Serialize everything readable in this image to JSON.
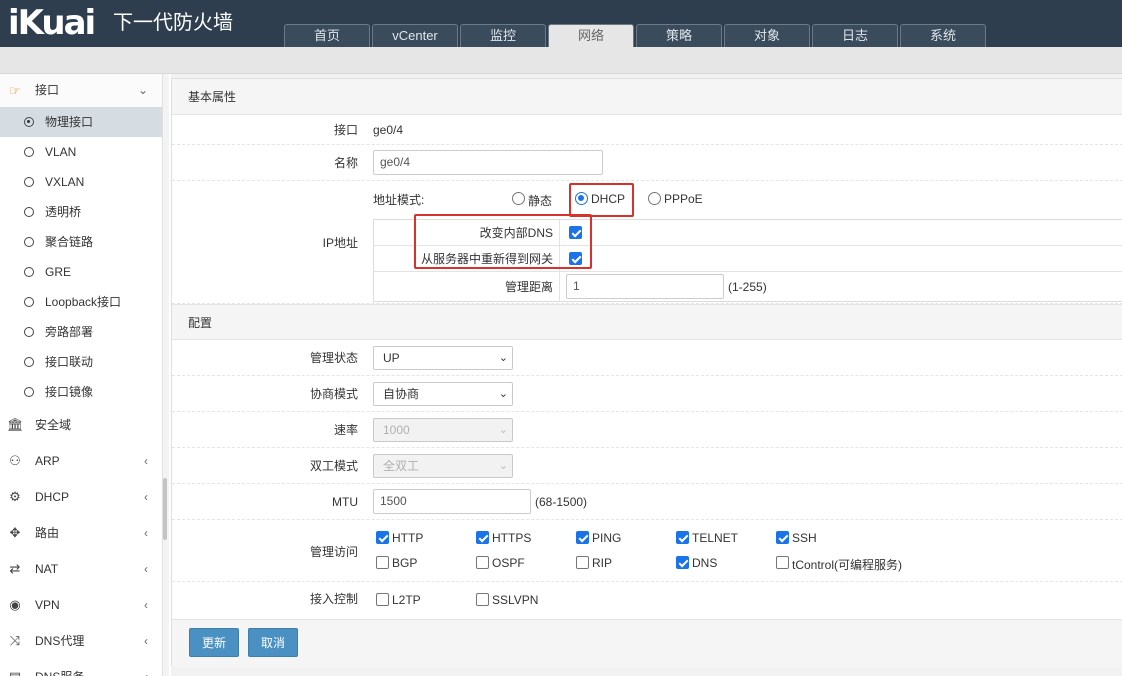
{
  "brand": {
    "logo": "iKuai",
    "subtitle": "下一代防火墙"
  },
  "nav": {
    "tabs": [
      {
        "label": "首页",
        "icon": "none"
      },
      {
        "label": "vCenter"
      },
      {
        "label": "监控"
      },
      {
        "label": "网络",
        "active": true
      },
      {
        "label": "策略"
      },
      {
        "label": "对象"
      },
      {
        "label": "日志"
      },
      {
        "label": "系统"
      }
    ]
  },
  "sidebar": {
    "head": {
      "label": "接口",
      "icon": "hand-pointer-icon"
    },
    "sub_items": [
      {
        "label": "物理接口",
        "active": true
      },
      {
        "label": "VLAN"
      },
      {
        "label": "VXLAN"
      },
      {
        "label": "透明桥"
      },
      {
        "label": "聚合链路"
      },
      {
        "label": "GRE"
      },
      {
        "label": "Loopback接口"
      },
      {
        "label": "旁路部署"
      },
      {
        "label": "接口联动"
      },
      {
        "label": "接口镜像"
      }
    ],
    "groups": [
      {
        "label": "安全域",
        "icon": "bank-icon",
        "glyph": "🏛"
      },
      {
        "label": "ARP",
        "icon": "person-icon",
        "glyph": "⚇"
      },
      {
        "label": "DHCP",
        "icon": "network-icon",
        "glyph": "⚙"
      },
      {
        "label": "路由",
        "icon": "move-icon",
        "glyph": "✥"
      },
      {
        "label": "NAT",
        "icon": "exchange-icon",
        "glyph": "⇄"
      },
      {
        "label": "VPN",
        "icon": "globe-icon",
        "glyph": "◉"
      },
      {
        "label": "DNS代理",
        "icon": "shuffle-icon",
        "glyph": "⤨"
      },
      {
        "label": "DNS服务",
        "icon": "server-icon",
        "glyph": "▤"
      }
    ]
  },
  "basic": {
    "section_title": "基本属性",
    "interface_label": "接口",
    "interface_value": "ge0/4",
    "name_label": "名称",
    "name_value": "ge0/4",
    "ip_label": "IP地址",
    "addr_mode_label": "地址模式:",
    "mode_static": "静态",
    "mode_dhcp": "DHCP",
    "mode_pppoe": "PPPoE",
    "selected_mode": "DHCP",
    "change_dns_label": "改变内部DNS",
    "change_dns_checked": true,
    "gateway_label": "从服务器中重新得到网关",
    "gateway_checked": true,
    "distance_label": "管理距离",
    "distance_value": "1",
    "distance_hint": "(1-255)"
  },
  "config": {
    "section_title": "配置",
    "admin_state_label": "管理状态",
    "admin_state_value": "UP",
    "negotiation_label": "协商模式",
    "negotiation_value": "自协商",
    "speed_label": "速率",
    "speed_value": "1000",
    "duplex_label": "双工模式",
    "duplex_value": "全双工",
    "mtu_label": "MTU",
    "mtu_value": "1500",
    "mtu_hint": "(68-1500)",
    "access_label": "管理访问",
    "access_options": [
      {
        "label": "HTTP",
        "checked": true
      },
      {
        "label": "HTTPS",
        "checked": true
      },
      {
        "label": "PING",
        "checked": true
      },
      {
        "label": "TELNET",
        "checked": true
      },
      {
        "label": "SSH",
        "checked": true
      },
      {
        "label": "BGP",
        "checked": false
      },
      {
        "label": "OSPF",
        "checked": false
      },
      {
        "label": "RIP",
        "checked": false
      },
      {
        "label": "DNS",
        "checked": true
      },
      {
        "label": "tControl(可编程服务)",
        "checked": false
      }
    ],
    "access_control_label": "接入控制",
    "access_control_options": [
      {
        "label": "L2TP",
        "checked": false
      },
      {
        "label": "SSLVPN",
        "checked": false
      }
    ]
  },
  "actions": {
    "update": "更新",
    "cancel": "取消"
  },
  "colors": {
    "topbar": "#2e3e4e",
    "accent": "#1a73e8",
    "highlight": "#d9312b",
    "button": "#4a90c2"
  }
}
